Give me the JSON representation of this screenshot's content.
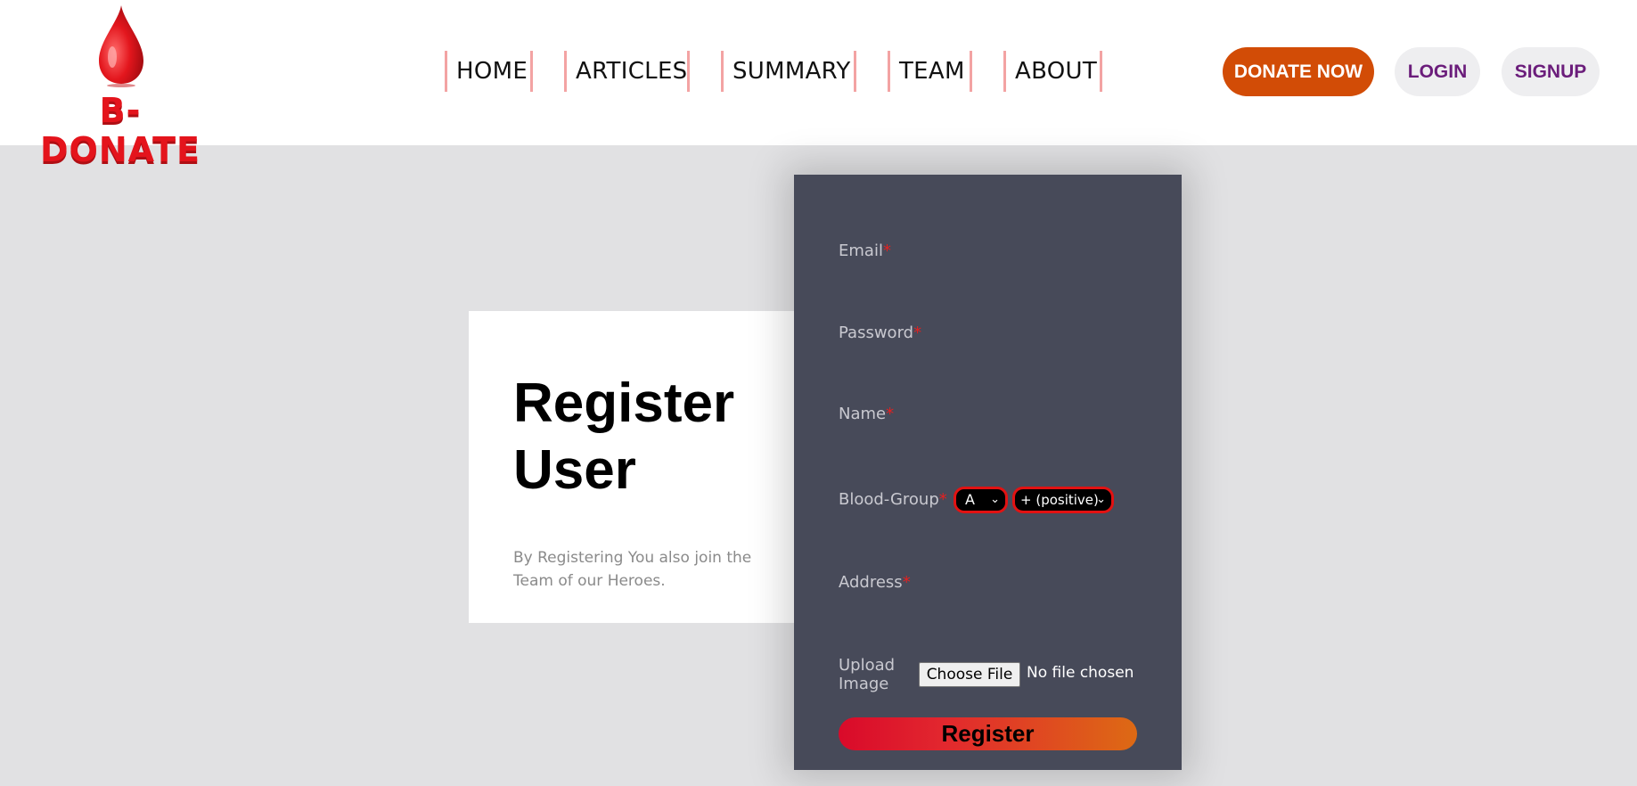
{
  "header": {
    "logo_text": "B-DONATE",
    "nav": [
      {
        "label": "HOME"
      },
      {
        "label": "ARTICLES"
      },
      {
        "label": "SUMMARY"
      },
      {
        "label": "TEAM"
      },
      {
        "label": "ABOUT"
      }
    ],
    "donate_label": "DONATE NOW",
    "login_label": "LOGIN",
    "signup_label": "SIGNUP"
  },
  "info": {
    "title": "Register User",
    "text": "By Registering You also join the Team of our Heroes."
  },
  "form": {
    "email_label": "Email",
    "password_label": "Password",
    "name_label": "Name",
    "blood_group_label": "Blood-Group",
    "blood_type_value": "A",
    "rh_value": "+ (positive)",
    "address_label": "Address",
    "upload_label": "Upload Image",
    "required_mark": "*",
    "file_button_label": "Choose File",
    "file_status": "No file chosen",
    "register_label": "Register"
  },
  "colors": {
    "donate": "#d24c06",
    "accent_purple": "#6b1d7b",
    "panel": "#474a59",
    "required": "#e52020"
  }
}
